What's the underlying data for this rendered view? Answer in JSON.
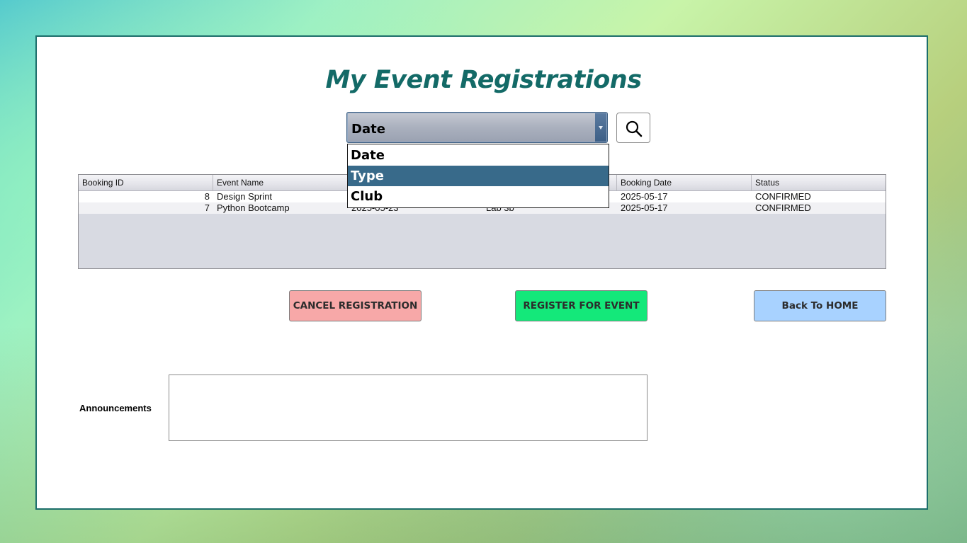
{
  "header": {
    "title": "My Event Registrations"
  },
  "filter": {
    "selected_value": "Date",
    "options": [
      "Date",
      "Type",
      "Club"
    ],
    "highlighted_option": "Type",
    "search_icon": "search-icon"
  },
  "table": {
    "columns": [
      "Booking ID",
      "Event Name",
      "",
      "",
      "Booking Date",
      "Status"
    ],
    "rows": [
      {
        "id": "8",
        "event": "Design Sprint",
        "col3": "",
        "col4": "",
        "booking_date": "2025-05-17",
        "status": "CONFIRMED"
      },
      {
        "id": "7",
        "event": "Python Bootcamp",
        "col3": "2025-05-23",
        "col4": "Lab 3b",
        "booking_date": "2025-05-17",
        "status": "CONFIRMED"
      }
    ]
  },
  "actions": {
    "cancel_label": "CANCEL REGISTRATION",
    "register_label": "REGISTER FOR EVENT",
    "home_label": "Back To HOME"
  },
  "announcements": {
    "label": "Announcements",
    "text": ""
  },
  "colors": {
    "title": "#136a67",
    "panel_border": "#1c6e6b",
    "dropdown_highlight": "#386a8a",
    "cancel_button": "#f7a8a8",
    "register_button": "#14e87a",
    "home_button": "#a8d2ff"
  }
}
